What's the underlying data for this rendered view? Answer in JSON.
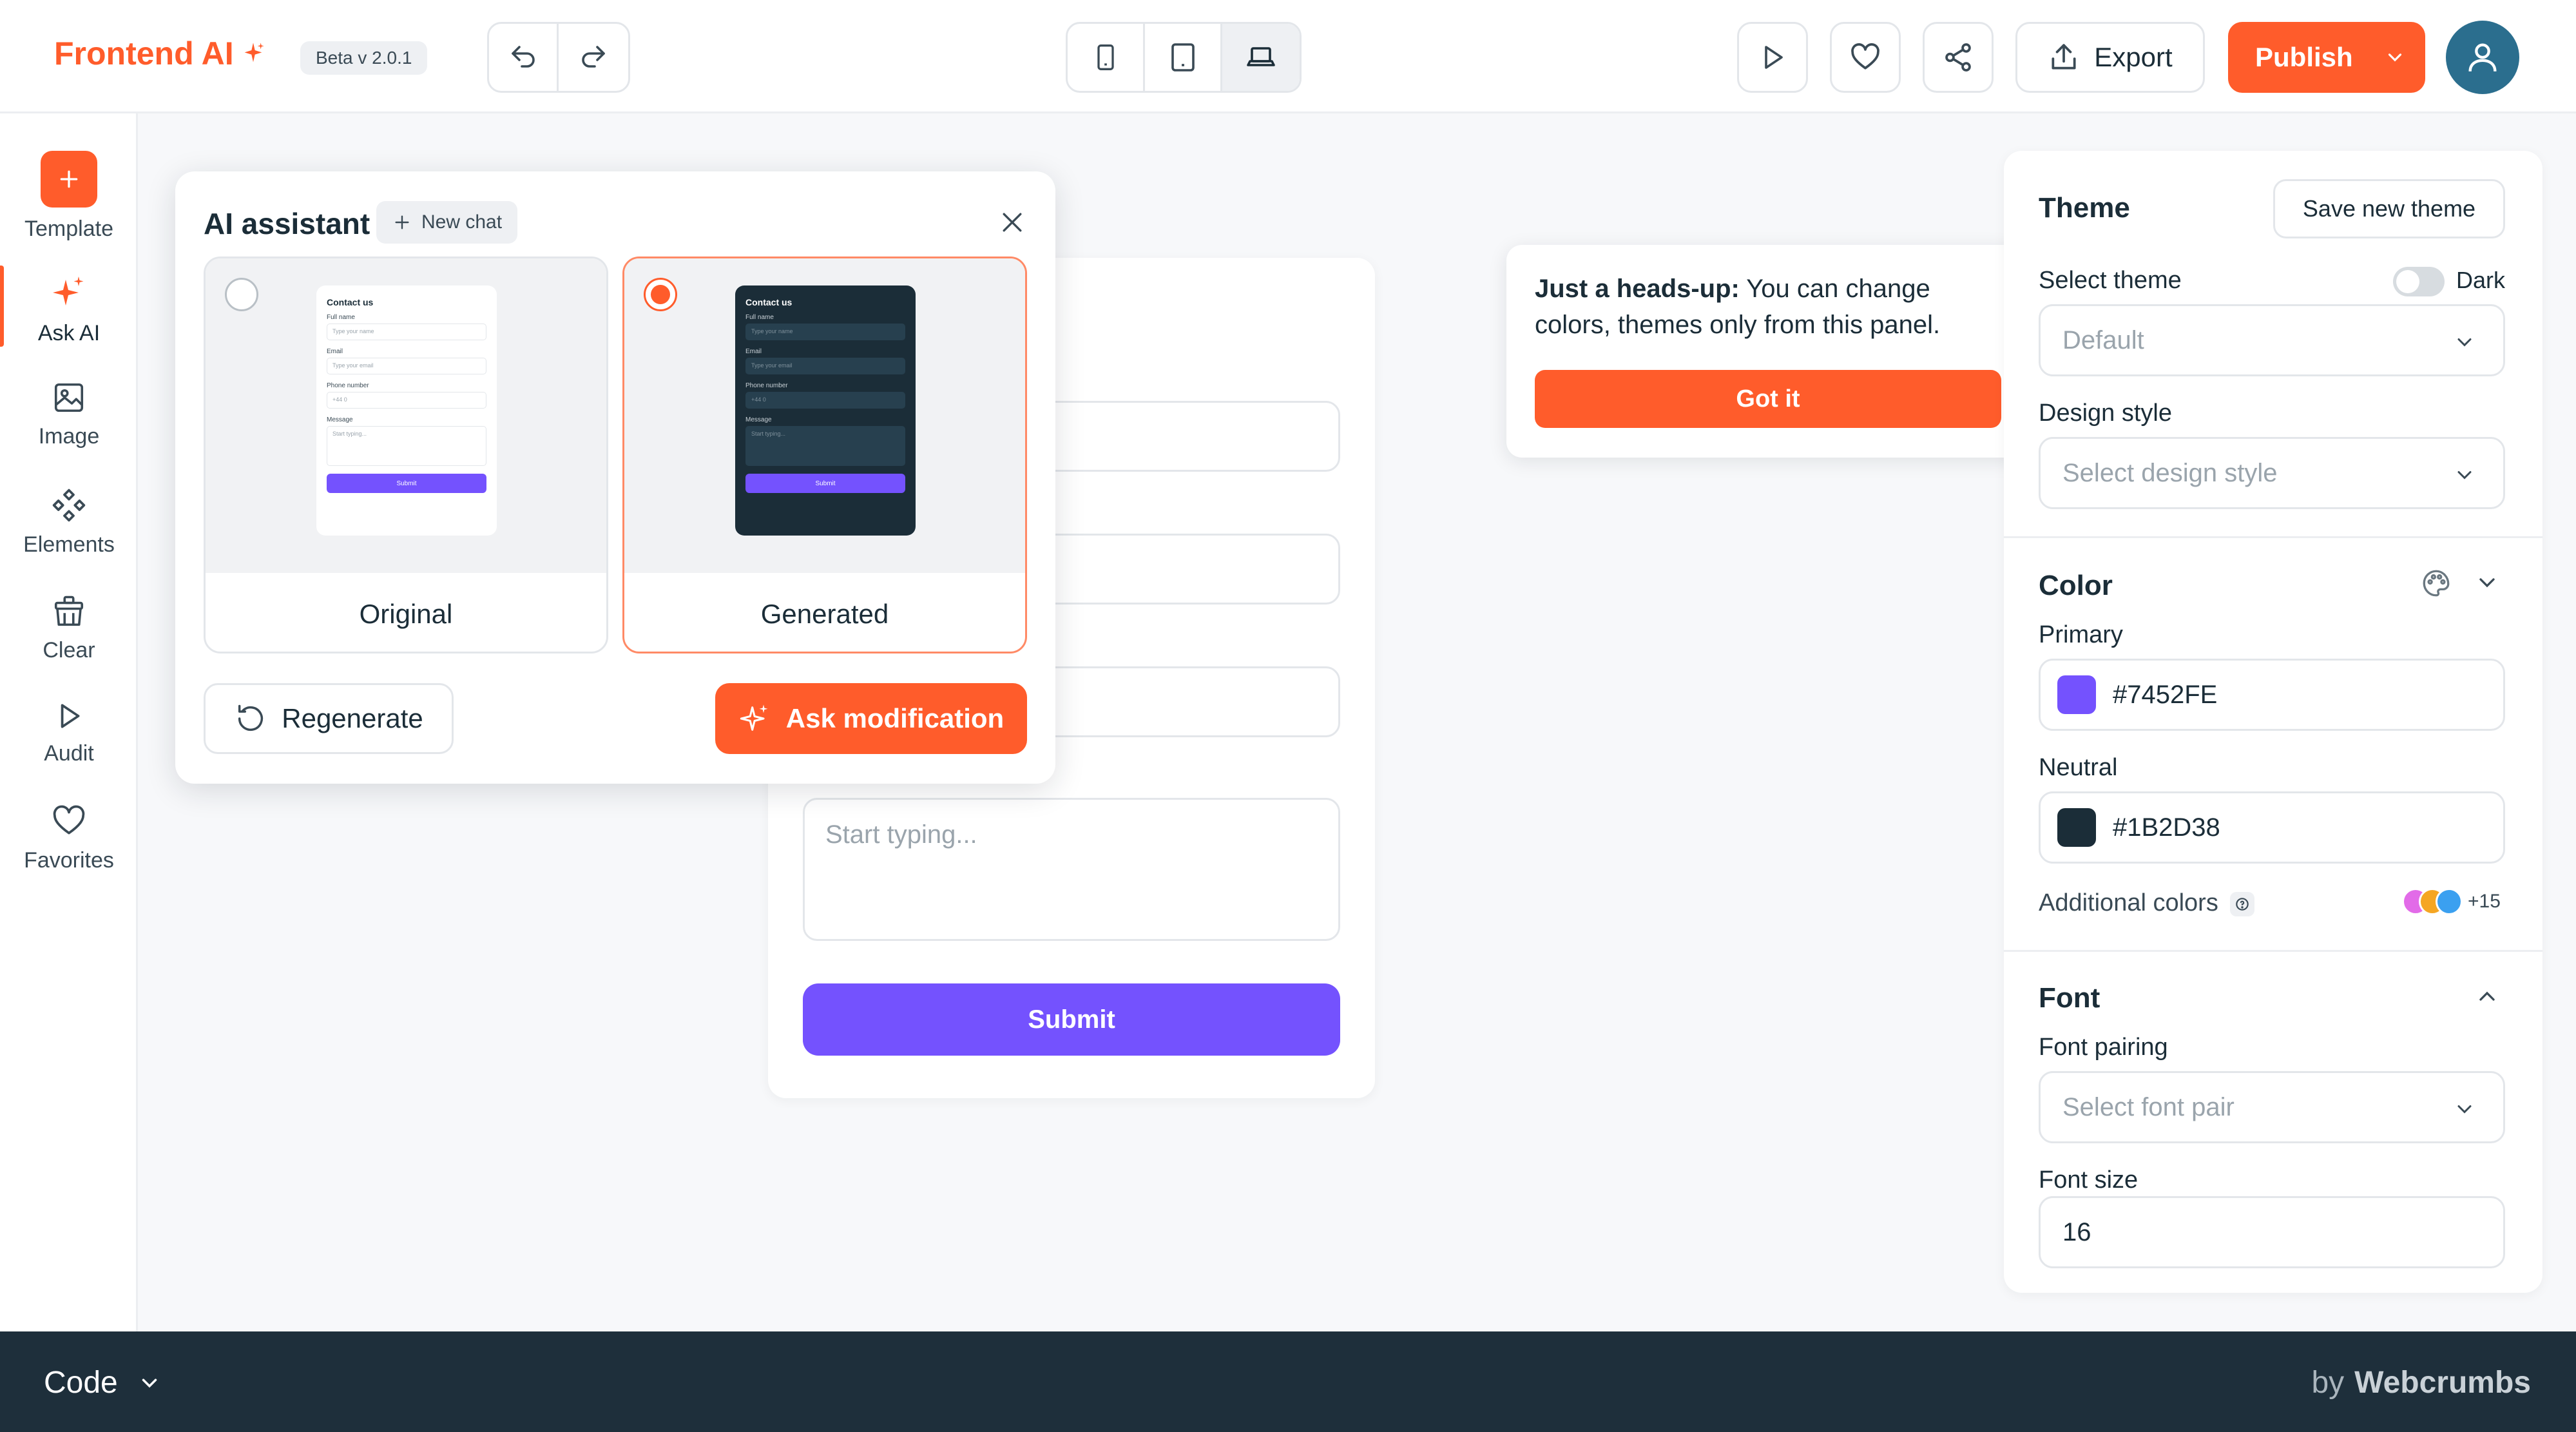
{
  "topbar": {
    "brand": "Frontend AI",
    "version": "Beta v 2.0.1",
    "export_label": "Export",
    "publish_label": "Publish"
  },
  "sidebar": {
    "items": [
      {
        "label": "Template",
        "icon": "plus-icon"
      },
      {
        "label": "Ask AI",
        "icon": "sparkle-icon"
      },
      {
        "label": "Image",
        "icon": "image-icon"
      },
      {
        "label": "Elements",
        "icon": "elements-icon"
      },
      {
        "label": "Clear",
        "icon": "broom-icon"
      },
      {
        "label": "Audit",
        "icon": "play-icon"
      },
      {
        "label": "Favorites",
        "icon": "heart-icon"
      }
    ]
  },
  "form": {
    "textarea_placeholder": "Start typing...",
    "submit_label": "Submit"
  },
  "ai_panel": {
    "title": "AI assistant",
    "new_chat": "New chat",
    "options": [
      {
        "label": "Original",
        "selected": false
      },
      {
        "label": "Generated",
        "selected": true
      }
    ],
    "preview": {
      "title": "Contact us",
      "fields": [
        {
          "label": "Full name",
          "placeholder": "Type your name"
        },
        {
          "label": "Email",
          "placeholder": "Type your email"
        },
        {
          "label": "Phone number",
          "placeholder": "+44 0"
        },
        {
          "label": "Message",
          "placeholder": "Start typing..."
        }
      ],
      "button": "Submit"
    },
    "regenerate_label": "Regenerate",
    "ask_modification_label": "Ask modification"
  },
  "headsup": {
    "bold": "Just a heads-up:",
    "text": " You can change colors, themes only from this panel.",
    "button": "Got it"
  },
  "theme_panel": {
    "title": "Theme",
    "save_label": "Save new theme",
    "select_theme_label": "Select theme",
    "dark_label": "Dark",
    "theme_value": "Default",
    "design_style_label": "Design style",
    "design_style_placeholder": "Select design style",
    "color_title": "Color",
    "primary_label": "Primary",
    "primary_value": "#7452FE",
    "neutral_label": "Neutral",
    "neutral_value": "#1B2D38",
    "additional_label": "Additional colors",
    "additional_count": "+15",
    "font_title": "Font",
    "font_pairing_label": "Font pairing",
    "font_pairing_placeholder": "Select font pair",
    "font_size_label": "Font size",
    "font_size_value": "16"
  },
  "codebar": {
    "label": "Code",
    "by": "by",
    "brand": "Webcrumbs"
  },
  "colors": {
    "accent": "#FF5C2B",
    "primary": "#7452FE",
    "neutral": "#1B2D38",
    "additional": [
      "#E26BE8",
      "#F5A623",
      "#3BA0F0"
    ]
  }
}
